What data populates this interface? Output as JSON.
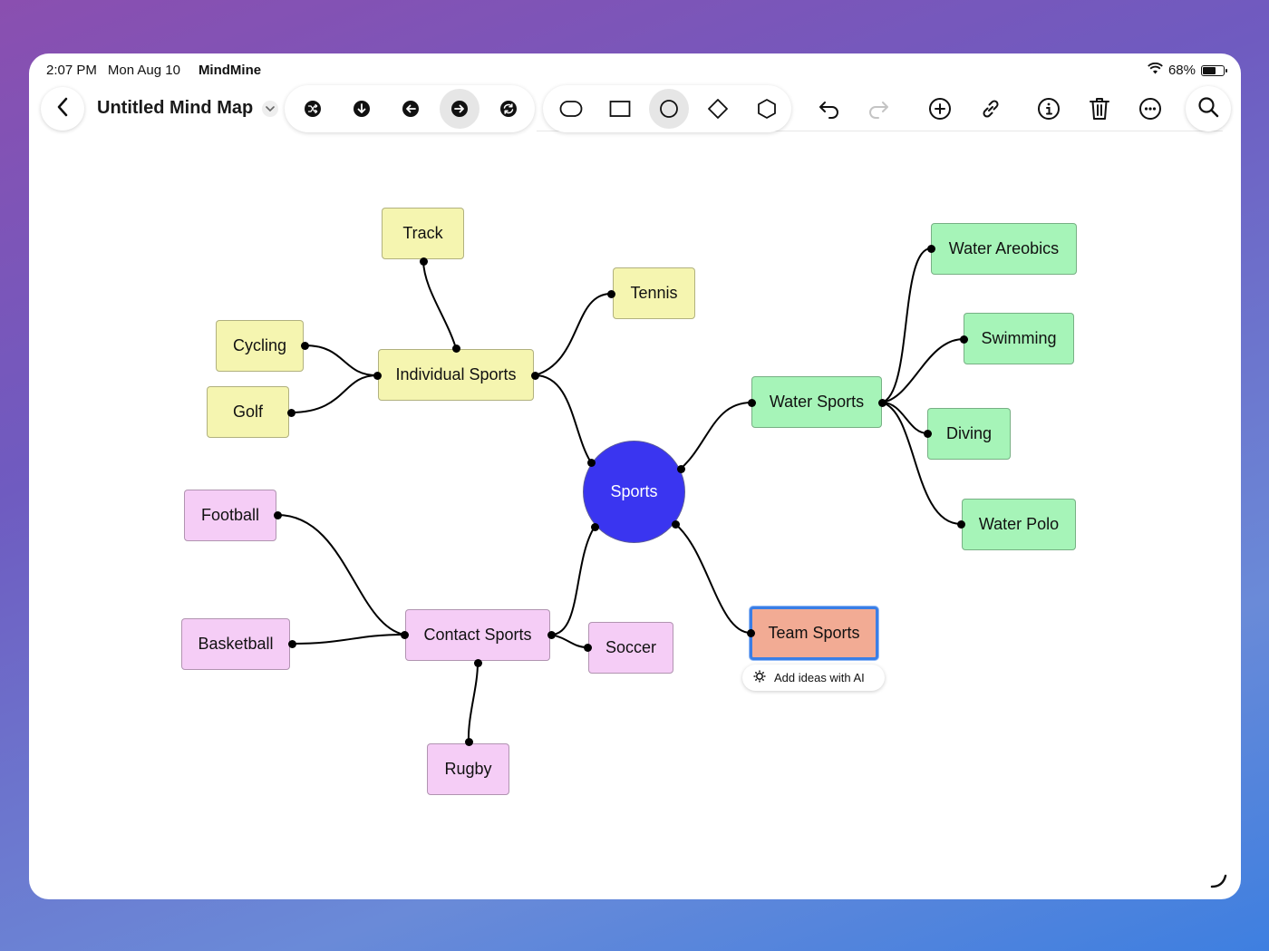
{
  "status": {
    "time": "2:07 PM",
    "date": "Mon Aug 10",
    "app_name": "MindMine",
    "battery": "68%",
    "battery_level": 0.68
  },
  "header": {
    "title": "Untitled Mind Map"
  },
  "toolbar": {
    "layout_icons": [
      "shuffle-icon",
      "arrow-down-icon",
      "arrow-left-icon",
      "arrow-right-icon",
      "refresh-icon"
    ],
    "active_layout": "arrow-right-icon",
    "shape_icons": [
      "rounded-rect-shape-icon",
      "rectangle-shape-icon",
      "circle-shape-icon",
      "diamond-shape-icon",
      "hexagon-shape-icon"
    ],
    "active_shape": "circle-shape-icon",
    "action_icons": [
      "undo-icon",
      "redo-icon",
      "add-icon",
      "link-icon",
      "info-icon",
      "trash-icon",
      "more-icon",
      "search-icon"
    ]
  },
  "colors": {
    "yellow": "#f5f5b0",
    "green": "#a6f4b8",
    "pink": "#f5cdf6",
    "salmon": "#f2ab94",
    "center": "#3a35f0",
    "selection": "#3a7ee6"
  },
  "map": {
    "center": "Sports",
    "individual": {
      "label": "Individual Sports",
      "children": [
        "Track",
        "Tennis",
        "Cycling",
        "Golf"
      ]
    },
    "water": {
      "label": "Water Sports",
      "children": [
        "Water Areobics",
        "Swimming",
        "Diving",
        "Water Polo"
      ]
    },
    "contact": {
      "label": "Contact Sports",
      "children": [
        "Football",
        "Basketball",
        "Soccer",
        "Rugby"
      ]
    },
    "team": {
      "label": "Team Sports"
    }
  },
  "ai_button": {
    "label": "Add ideas with AI"
  }
}
